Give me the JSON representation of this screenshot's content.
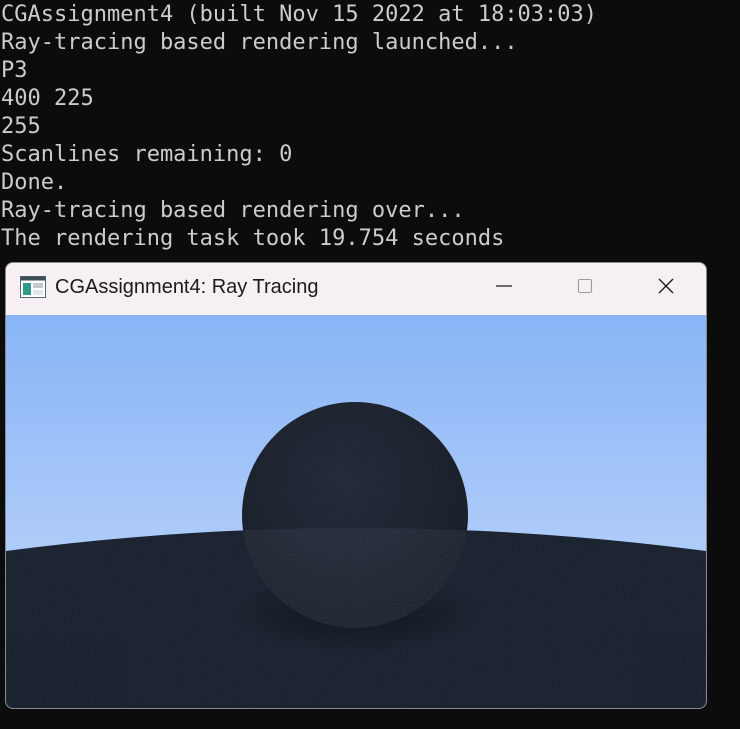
{
  "console": {
    "lines": [
      "CGAssignment4 (built Nov 15 2022 at 18:03:03)",
      "Ray-tracing based rendering launched...",
      "P3",
      "400 225",
      "255",
      "Scanlines remaining: 0",
      "Done.",
      "Ray-tracing based rendering over...",
      "The rendering task took 19.754 seconds"
    ]
  },
  "window": {
    "title": "CGAssignment4: Ray Tracing",
    "icon": "app-window-icon",
    "controls": {
      "minimize": "minimize-icon",
      "maximize": "maximize-icon",
      "close": "close-icon"
    }
  },
  "render": {
    "sky_top_color": "#88b4f6",
    "sky_bottom_color": "#c9dcfb",
    "ground_color": "#121a26",
    "sphere_color": "#161c26"
  }
}
